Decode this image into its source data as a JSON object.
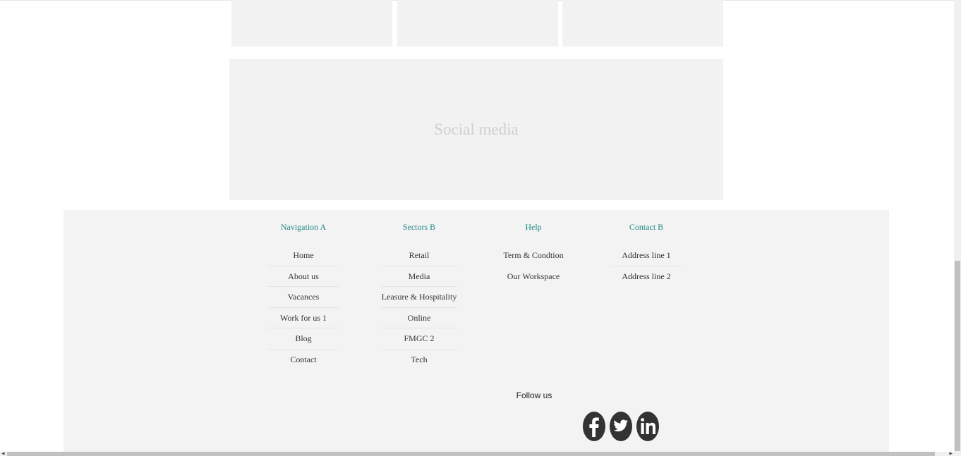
{
  "social_media_placeholder": "Social media",
  "footer": {
    "columns": [
      {
        "title": "Navigation A",
        "items": [
          "Home",
          "About us",
          "Vacances",
          "Work for us 1",
          "Blog",
          "Contact"
        ]
      },
      {
        "title": "Sectors B",
        "items": [
          "Retail",
          "Media",
          "Leasure & Hospitality",
          "Online",
          "FMGC 2",
          "Tech"
        ]
      },
      {
        "title": "Help",
        "items": [
          "Term & Condtion",
          "Our Workspace"
        ]
      },
      {
        "title": "Contact B",
        "items": [
          "Address line 1",
          "Address line 2"
        ]
      }
    ],
    "follow_label": "Follow us",
    "social_icons": [
      "facebook-icon",
      "twitter-icon",
      "linkedin-icon"
    ]
  },
  "colors": {
    "heading_accent": "#1f8a85",
    "panel_bg": "#f2f2f2",
    "icon_fill": "#333333"
  }
}
